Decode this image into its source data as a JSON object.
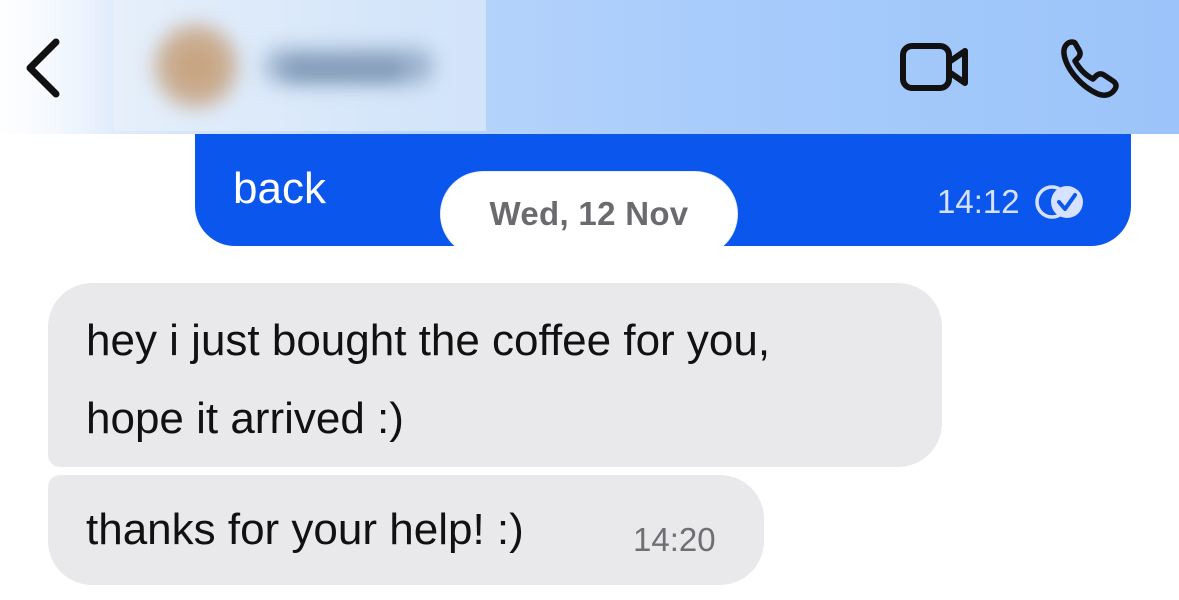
{
  "header": {
    "back_icon": "chevron-left-icon",
    "video_icon": "video-camera-icon",
    "call_icon": "phone-icon",
    "colors": {
      "icon": "#111111",
      "bar_start": "#f4f8fd",
      "bar_end": "#9cc4fa"
    }
  },
  "messages": {
    "outgoing_last": {
      "text": "back",
      "time": "14:12",
      "status_icon": "read-checkmark-icon",
      "bubble_color": "#0b57ed"
    },
    "date_separator": "Wed, 12 Nov",
    "incoming": [
      {
        "lines": [
          "hey i just bought the coffee for you,",
          "hope it arrived :)"
        ]
      },
      {
        "text": "thanks for your help! :)",
        "time": "14:20"
      }
    ],
    "incoming_bubble_color": "#e9e9eb"
  }
}
